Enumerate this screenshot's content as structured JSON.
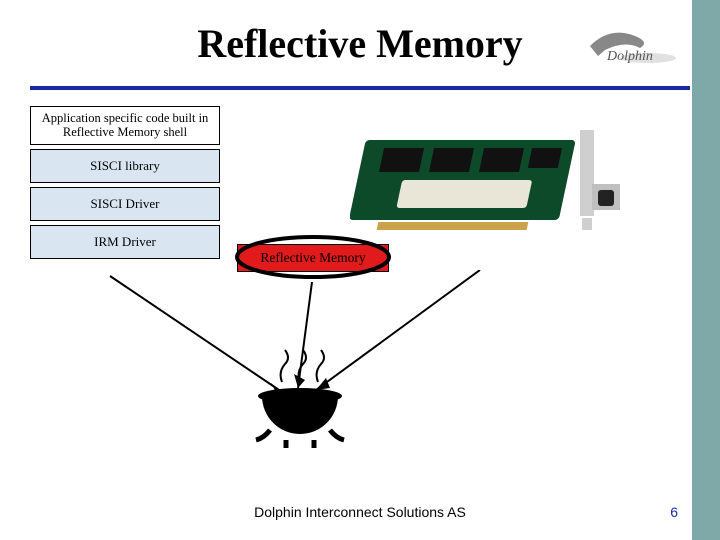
{
  "title": "Reflective Memory",
  "logo_text": "Dolphin",
  "stack": {
    "top": "Application specific code built in Reflective Memory shell",
    "items": [
      "SISCI library",
      "SISCI Driver",
      "IRM Driver"
    ]
  },
  "reflective_box": "Reflective Memory",
  "footer": "Dolphin Interconnect Solutions AS",
  "page_number": "6",
  "colors": {
    "accent": "#1a2aa0",
    "sidebar": "#7fa8a8",
    "highlight": "#e11b1b",
    "shade": "#d9e6f2"
  }
}
